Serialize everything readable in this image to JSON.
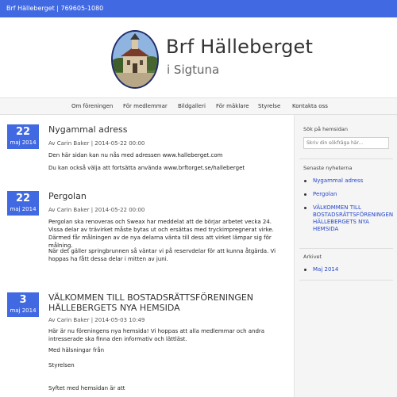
{
  "topbar": {
    "text": "Brf Hälleberget | 769605-1080"
  },
  "brand": {
    "title": "Brf Hälleberget",
    "subtitle": "i Sigtuna"
  },
  "nav": {
    "items": [
      "Om föreningen",
      "För medlemmar",
      "Bildgalleri",
      "För mäklare",
      "Styrelse",
      "Kontakta oss"
    ]
  },
  "posts": [
    {
      "day": "22",
      "month": "maj 2014",
      "title": "Nygammal adress",
      "meta": "Av Carin Baker | 2014-05-22 00:00",
      "paragraphs": [
        "Den här sidan kan nu nås med adressen www.halleberget.com",
        "Du kan också välja att fortsätta använda www.brftorget.se/halleberget"
      ]
    },
    {
      "day": "22",
      "month": "maj 2014",
      "title": "Pergolan",
      "meta": "Av Carin Baker | 2014-05-22 00:00",
      "paragraphs": [
        "Pergolan ska renoveras och Sweax har meddelat att de börjar arbetet vecka 24. Vissa delar av trävirket måste bytas ut och ersättas med tryckimpregnerat virke. Därmed får målningen av de nya delarna vänta till dess att virket lämpar sig för målning.",
        "När det gäller springbrunnen så väntar vi på reservdelar för att kunna åtgärda. Vi hoppas ha fått dessa delar i mitten av juni."
      ]
    },
    {
      "day": "3",
      "month": "maj 2014",
      "title": "VÄLKOMMEN TILL BOSTADSRÄTTSFÖRENINGEN HÄLLEBERGETS NYA HEMSIDA",
      "meta": "Av Carin Baker | 2014-05-03 10:49",
      "paragraphs": [
        "Här är nu föreningens nya hemsida! Vi hoppas att alla medlemmar och andra intresserade ska finna den informativ och lättläst.",
        "Med hälsningar från",
        "Styrelsen",
        "Syftet med hemsidan är att"
      ]
    }
  ],
  "sidebar": {
    "search_title": "Sök på hemsidan",
    "search_placeholder": "Skriv din sökfråga här...",
    "news_title": "Senaste nyheterna",
    "news": [
      "Nygammal adress",
      "Pergolan",
      "VÄLKOMMEN TILL BOSTADSRÄTTSFÖRENINGEN HÄLLEBERGETS NYA HEMSIDA"
    ],
    "archive_title": "Arkivet",
    "archive": [
      "Maj 2014"
    ]
  },
  "colors": {
    "accent": "#4169e1",
    "link": "#2748c9"
  },
  "icons": {
    "logo": "church-building-photo-logo"
  }
}
